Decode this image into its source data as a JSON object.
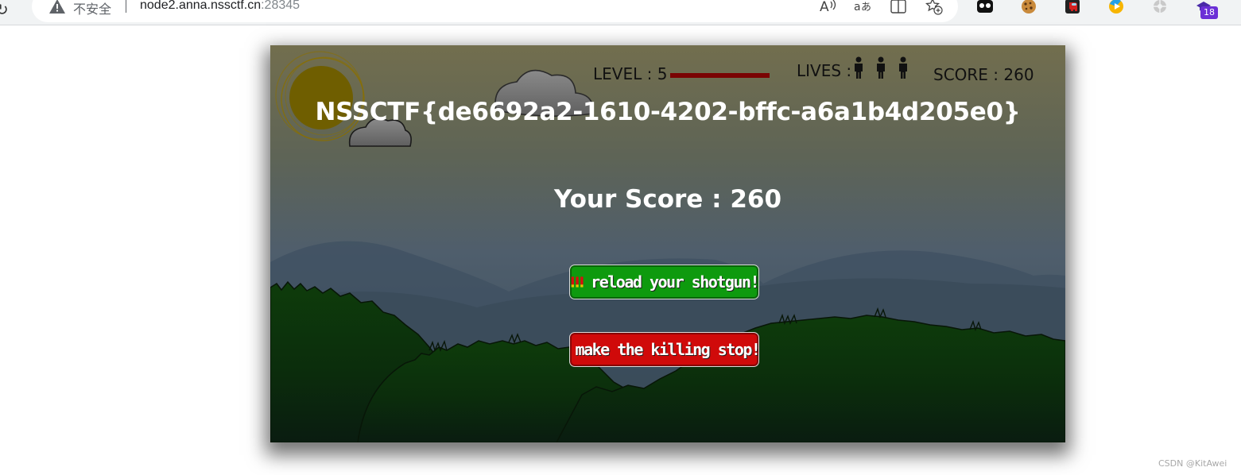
{
  "browser": {
    "security_label": "不安全",
    "url_host": "node2.anna.nssctf.cn",
    "url_port": ":28345",
    "extension_badge": "18",
    "icons": [
      "reload-icon",
      "warning-icon",
      "read-aloud-icon",
      "translate-icon",
      "split-screen-icon",
      "favorites-add-icon",
      "extension-icon-1",
      "extension-icon-cookie",
      "extension-icon-among-us",
      "extension-icon-play",
      "extension-icon-gray",
      "extension-icon-hat"
    ]
  },
  "hud": {
    "level_label": "LEVEL : 5",
    "level_progress": 1.0,
    "lives_label": "LIVES :",
    "lives_count": 3,
    "score_label": "SCORE : 260"
  },
  "game": {
    "flag": "NSSCTF{de6692a2-1610-4202-bffc-a6a1b4d205e0}",
    "final_score": "Your Score : 260",
    "reload_button": "reload your shotgun!",
    "stop_button": "make the killing stop!"
  },
  "colors": {
    "reload_button": "#0e9a0e",
    "stop_button": "#d00a0a",
    "level_bar": "#7a0303",
    "sun": "#6f5e00"
  },
  "watermark": "CSDN @KitAwei"
}
